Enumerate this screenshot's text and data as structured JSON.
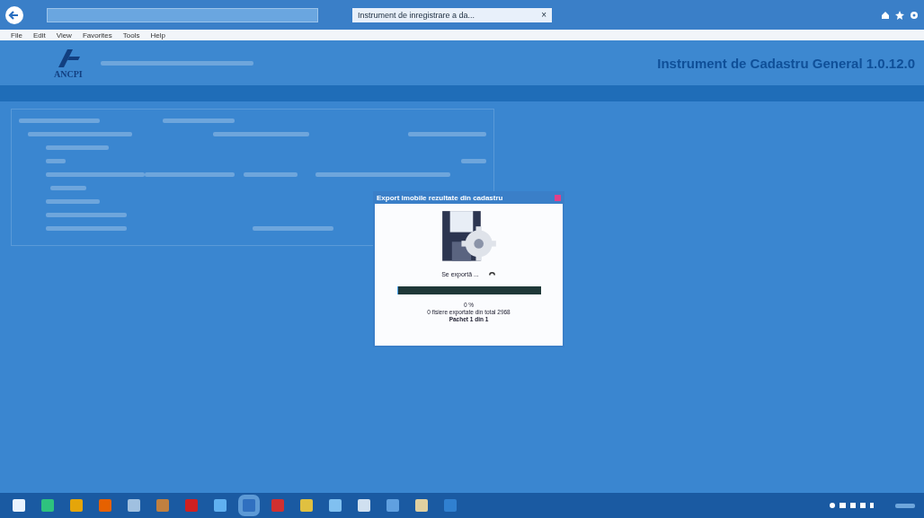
{
  "browser": {
    "tab_title": "Instrument de inregistrare a da...",
    "tab_close": "×",
    "menu": [
      "File",
      "Edit",
      "View",
      "Favorites",
      "Tools",
      "Help"
    ]
  },
  "header": {
    "logo": "ANCPI",
    "app_title": "Instrument de Cadastru General 1.0.12.0"
  },
  "dialog": {
    "title": "Export imobile rezultate din cadastru",
    "status": "Se exportă ...",
    "progress": {
      "level": 0
    },
    "percent": "0 %",
    "files": "0 fisiere exportate din total 2968",
    "package": "Pachet 1 din 1"
  }
}
